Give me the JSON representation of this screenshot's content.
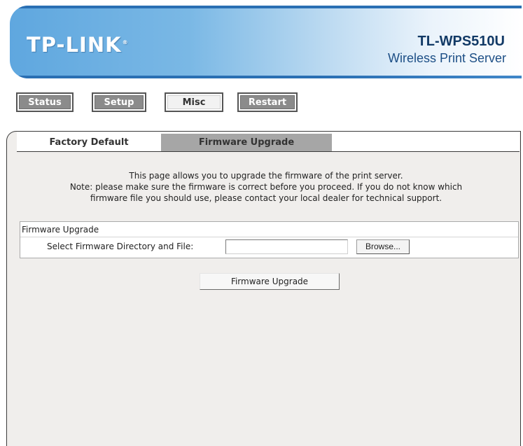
{
  "header": {
    "logo_text": "TP-LINK",
    "logo_mark": "®",
    "model": "TL-WPS510U",
    "subtitle": "Wireless Print Server"
  },
  "nav": {
    "items": [
      {
        "label": "Status"
      },
      {
        "label": "Setup"
      },
      {
        "label": "Misc"
      },
      {
        "label": "Restart"
      }
    ],
    "active": "Misc"
  },
  "subtabs": {
    "items": [
      {
        "label": "Factory Default"
      },
      {
        "label": "Firmware Upgrade"
      }
    ],
    "selected": "Firmware Upgrade"
  },
  "main": {
    "description_line1": "This page allows you to upgrade the firmware of the print server.",
    "description_line2": "Note: please make sure the firmware is correct before you proceed. If you do not know which",
    "description_line3": "firmware file you should use, please contact your local dealer for technical support.",
    "firmware_box": {
      "title": "Firmware Upgrade",
      "field_label": "Select Firmware Directory and File:",
      "file_value": "",
      "browse_label": "Browse..."
    },
    "submit_label": "Firmware Upgrade"
  },
  "colors": {
    "header_blue": "#5fa7df",
    "header_dark_blue": "#2a6fb3",
    "nav_button_gray": "#8b8b8b",
    "selected_subtab": "#a6a6a6",
    "panel_background": "#f0eeec"
  }
}
